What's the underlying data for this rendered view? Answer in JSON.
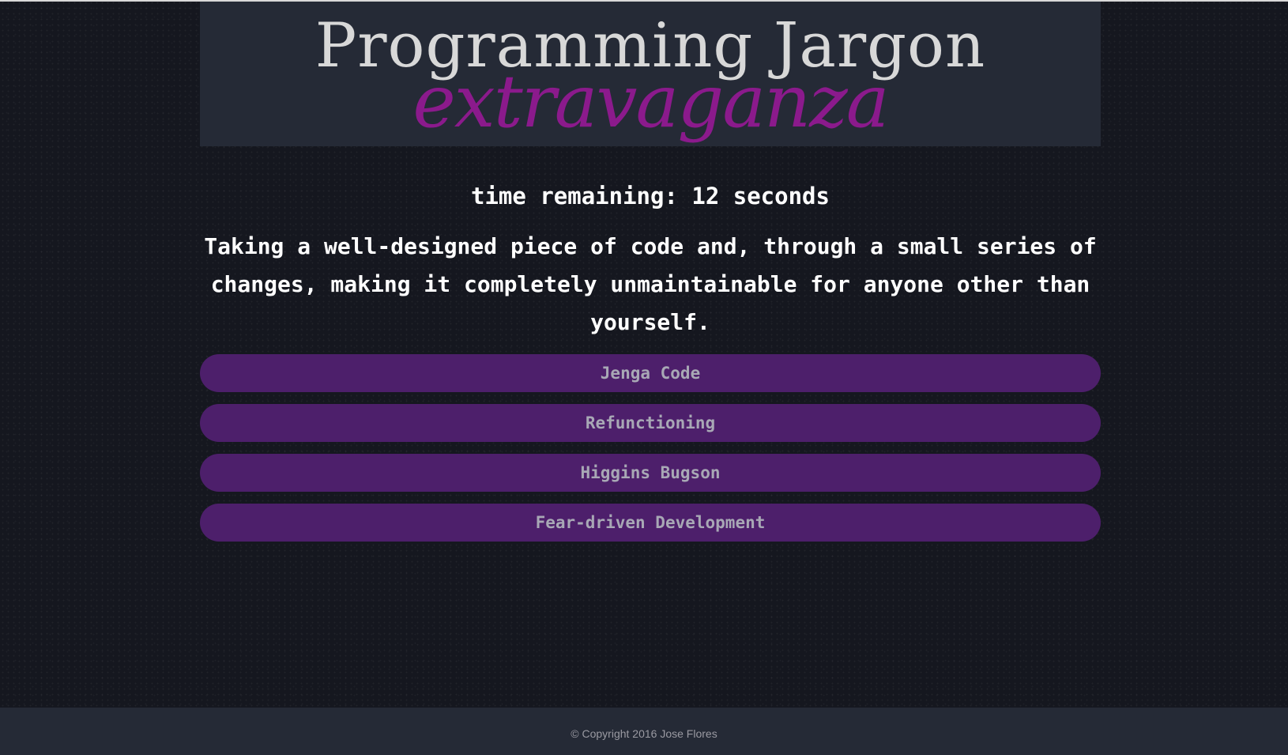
{
  "header": {
    "title": "Programming Jargon",
    "subtitle": "extravaganza"
  },
  "game": {
    "timer_text": "time remaining: 12 seconds",
    "question": "Taking a well-designed piece of code and, through a small series of changes, making it completely unmaintainable for anyone other than yourself.",
    "answers": [
      {
        "label": "Jenga Code"
      },
      {
        "label": "Refunctioning"
      },
      {
        "label": "Higgins Bugson"
      },
      {
        "label": "Fear-driven Development"
      }
    ]
  },
  "footer": {
    "copyright": "© Copyright 2016 Jose Flores"
  },
  "colors": {
    "background": "#15171f",
    "panel": "#252a36",
    "accent_purple": "#8b1a8c",
    "button_purple": "#4d1f6b",
    "title_text": "#d8d8d8"
  }
}
